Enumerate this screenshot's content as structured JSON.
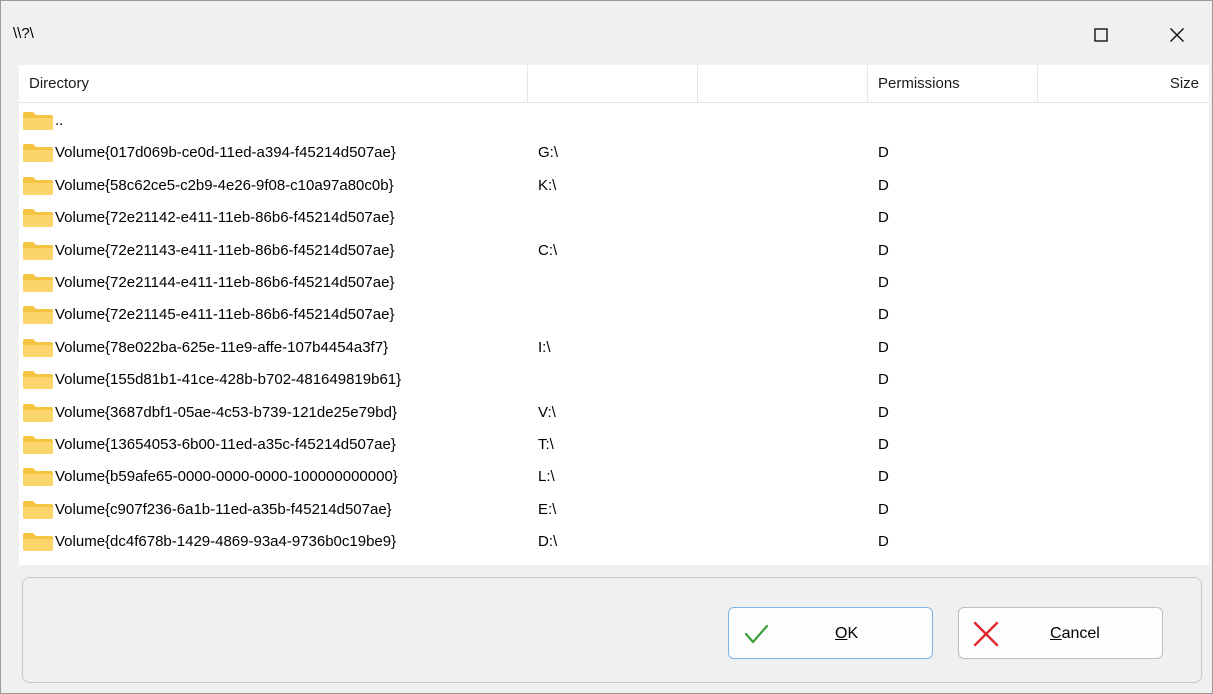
{
  "window": {
    "title": "\\\\?\\"
  },
  "columns": {
    "directory": "Directory",
    "col2": "",
    "col3": "",
    "permissions": "Permissions",
    "size": "Size"
  },
  "rows": [
    {
      "name": "..",
      "drive": "",
      "perm": "",
      "size": ""
    },
    {
      "name": "Volume{017d069b-ce0d-11ed-a394-f45214d507ae}",
      "drive": "G:\\",
      "perm": "D",
      "size": ""
    },
    {
      "name": "Volume{58c62ce5-c2b9-4e26-9f08-c10a97a80c0b}",
      "drive": "K:\\",
      "perm": "D",
      "size": ""
    },
    {
      "name": "Volume{72e21142-e411-11eb-86b6-f45214d507ae}",
      "drive": "",
      "perm": "D",
      "size": ""
    },
    {
      "name": "Volume{72e21143-e411-11eb-86b6-f45214d507ae}",
      "drive": "C:\\",
      "perm": "D",
      "size": ""
    },
    {
      "name": "Volume{72e21144-e411-11eb-86b6-f45214d507ae}",
      "drive": "",
      "perm": "D",
      "size": ""
    },
    {
      "name": "Volume{72e21145-e411-11eb-86b6-f45214d507ae}",
      "drive": "",
      "perm": "D",
      "size": ""
    },
    {
      "name": "Volume{78e022ba-625e-11e9-affe-107b4454a3f7}",
      "drive": "I:\\",
      "perm": "D",
      "size": ""
    },
    {
      "name": "Volume{155d81b1-41ce-428b-b702-481649819b61}",
      "drive": "",
      "perm": "D",
      "size": ""
    },
    {
      "name": "Volume{3687dbf1-05ae-4c53-b739-121de25e79bd}",
      "drive": "V:\\",
      "perm": "D",
      "size": ""
    },
    {
      "name": "Volume{13654053-6b00-11ed-a35c-f45214d507ae}",
      "drive": "T:\\",
      "perm": "D",
      "size": ""
    },
    {
      "name": "Volume{b59afe65-0000-0000-0000-100000000000}",
      "drive": "L:\\",
      "perm": "D",
      "size": ""
    },
    {
      "name": "Volume{c907f236-6a1b-11ed-a35b-f45214d507ae}",
      "drive": "E:\\",
      "perm": "D",
      "size": ""
    },
    {
      "name": "Volume{dc4f678b-1429-4869-93a4-9736b0c19be9}",
      "drive": "D:\\",
      "perm": "D",
      "size": ""
    }
  ],
  "buttons": {
    "ok": {
      "label_underlined": "O",
      "label_rest": "K"
    },
    "cancel": {
      "label_underlined": "C",
      "label_rest": "ancel"
    }
  },
  "icons": {
    "maximize": "maximize-icon",
    "close": "close-icon",
    "folder": "folder-icon",
    "ok": "checkmark-icon",
    "cancel": "x-icon"
  },
  "colors": {
    "folder": "#f6c443",
    "ok_check": "#3a9d3a",
    "cancel_x": "#e0282e",
    "ok_border": "#7fb5e6"
  }
}
